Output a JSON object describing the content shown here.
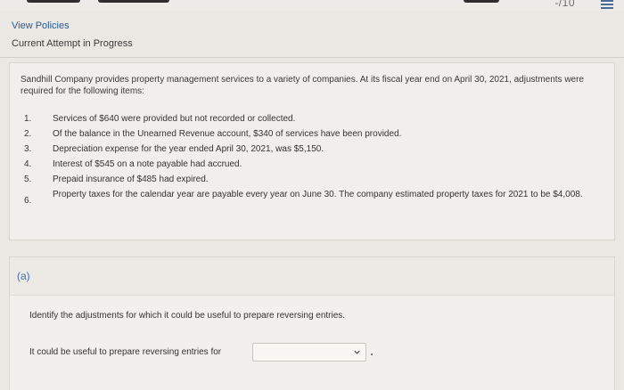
{
  "header": {
    "score_text": "-/10"
  },
  "nav": {
    "view_policies": "View Policies",
    "attempt_status": "Current Attempt in Progress"
  },
  "question": {
    "intro": "Sandhill Company provides property management services to a variety of companies. At its fiscal year end on April 30, 2021, adjustments were required for the following items:",
    "items": [
      {
        "num": "1.",
        "text": "Services of $640 were provided but not recorded or collected."
      },
      {
        "num": "2.",
        "text": "Of the balance in the Unearned Revenue account, $340 of services have been provided."
      },
      {
        "num": "3.",
        "text": "Depreciation expense for the year ended April 30, 2021, was $5,150."
      },
      {
        "num": "4.",
        "text": "Interest of $545 on a note payable had accrued."
      },
      {
        "num": "5.",
        "text": "Prepaid insurance of $485 had expired."
      },
      {
        "num": "6.",
        "text": "Property taxes for the calendar year are payable every year on June 30. The company estimated property taxes for 2021 to be $4,008."
      }
    ]
  },
  "part_a": {
    "label": "(a)",
    "instruction": "Identify the adjustments for which it could be useful to prepare reversing entries.",
    "answer_label": "It could be useful to prepare reversing entries for",
    "select_value": ""
  }
}
